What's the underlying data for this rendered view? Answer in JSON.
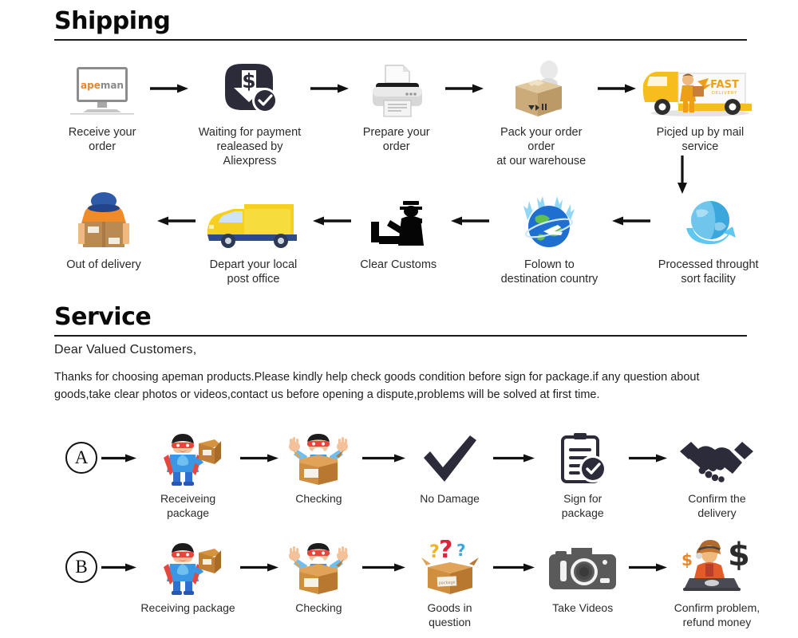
{
  "shipping": {
    "heading": "Shipping",
    "row1": [
      {
        "label": "Receive your order",
        "icon": "monitor-apeman-icon"
      },
      {
        "label": "Waiting for payment\nrealeased by Aliexpress",
        "icon": "payment-dollar-check-icon"
      },
      {
        "label": "Prepare your order",
        "icon": "printer-icon"
      },
      {
        "label": "Pack your order order\nat our warehouse",
        "icon": "person-packing-box-icon"
      },
      {
        "label": "Picjed up by mail service",
        "icon": "fast-delivery-truck-icon"
      }
    ],
    "row2": [
      {
        "label": "Out of delivery",
        "icon": "courier-holding-box-icon"
      },
      {
        "label": "Depart your local\npost office",
        "icon": "yellow-van-icon"
      },
      {
        "label": "Clear Customs",
        "icon": "customs-officer-icon"
      },
      {
        "label": "Folown to\ndestination country",
        "icon": "globe-airplane-icon"
      },
      {
        "label": "Processed throught\nsort facility",
        "icon": "globe-sort-facility-icon"
      }
    ],
    "truck_badge": "FAST",
    "truck_badge_sub": "DELIVERY",
    "logo_part1": "ape",
    "logo_part2": "man"
  },
  "service": {
    "heading": "Service",
    "greeting": "Dear Valued Customers,",
    "paragraph": "Thanks for choosing apeman products.Please kindly help check goods condition before sign for package.if any question about goods,take clear photos or videos,contact us before opening a dispute,problems will be solved at first time.",
    "rowA": {
      "letter": "A",
      "steps": [
        {
          "label": "Receiveing package",
          "icon": "hero-with-box-icon"
        },
        {
          "label": "Checking",
          "icon": "hero-in-open-box-icon"
        },
        {
          "label": "No Damage",
          "icon": "checkmark-icon"
        },
        {
          "label": "Sign for package",
          "icon": "clipboard-check-icon"
        },
        {
          "label": "Confirm the delivery",
          "icon": "handshake-icon"
        }
      ]
    },
    "rowB": {
      "letter": "B",
      "steps": [
        {
          "label": "Receiving package",
          "icon": "hero-with-box-icon"
        },
        {
          "label": "Checking",
          "icon": "hero-in-open-box-icon"
        },
        {
          "label": "Goods in question",
          "icon": "box-question-marks-icon"
        },
        {
          "label": "Take Videos",
          "icon": "camera-icon"
        },
        {
          "label": "Confirm problem,\nrefund money",
          "icon": "support-agent-refund-icon"
        }
      ]
    },
    "box_label": "package"
  },
  "colors": {
    "rule": "#1a1a1a",
    "text": "#2b2b2b",
    "dark_icon": "#2b2b3a",
    "orange": "#e8862a",
    "yellow": "#f7c325",
    "blue": "#2f6fd0",
    "gray_icon": "#5a5a5a",
    "box_brown": "#c08a4e"
  }
}
